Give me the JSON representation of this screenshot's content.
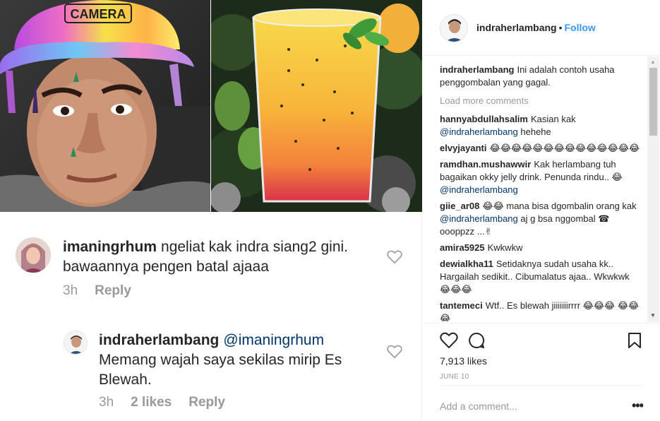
{
  "screenshot": {
    "comment_1": {
      "username": "imaningrhum",
      "text": "ngeliat kak indra siang2 gini. bawaannya pengen batal ajaaa",
      "time": "3h",
      "reply_label": "Reply"
    },
    "comment_2": {
      "username": "indraherlambang",
      "mention": "@imaningrhum",
      "text": "Memang wajah saya sekilas mirip Es Blewah.",
      "time": "3h",
      "likes": "2 likes",
      "reply_label": "Reply"
    },
    "overlay_sticker_text": "CAMERA"
  },
  "post": {
    "owner": "indraherlambang",
    "separator": "•",
    "follow_label": "Follow",
    "caption": {
      "username": "indraherlambang",
      "text": "Ini adalah contoh usaha penggombalan yang gagal."
    },
    "load_more_label": "Load more comments",
    "comments": [
      {
        "username": "hannyabdullahsalim",
        "text": "Kasian kak ",
        "mention": "@indraherlambang",
        "after": " hehehe"
      },
      {
        "username": "elvyjayanti",
        "text": "😂😂😂😂😂😂😂😂😂😂😂😂😂😂",
        "mention": "",
        "after": ""
      },
      {
        "username": "ramdhan.mushawwir",
        "text": "Kak herlambang tuh bagaikan okky jelly drink. Penunda rindu.. 😂 ",
        "mention": "@indraherlambang",
        "after": ""
      },
      {
        "username": "giie_ar08",
        "text": "😂😂 mana bisa dgombalin orang kak ",
        "mention": "@indraherlambang",
        "after": " aj g bsa nggombal ☎ oooppzz ...✌"
      },
      {
        "username": "amira5925",
        "text": "Kwkwkw",
        "mention": "",
        "after": ""
      },
      {
        "username": "dewialkha11",
        "text": "Setidaknya sudah usaha kk.. Hargailah sedikit.. Cibumalatus ajaa.. Wkwkwk 😂😂😂",
        "mention": "",
        "after": ""
      },
      {
        "username": "tantemeci",
        "text": "Wtf.. Es blewah jiiiiiiirrrr 😂😂😂 😂😂😂",
        "mention": "",
        "after": ""
      }
    ],
    "likes_text": "7,913 likes",
    "date_text": "JUNE 10",
    "add_comment_placeholder": "Add a comment...",
    "more_label": "•••"
  }
}
